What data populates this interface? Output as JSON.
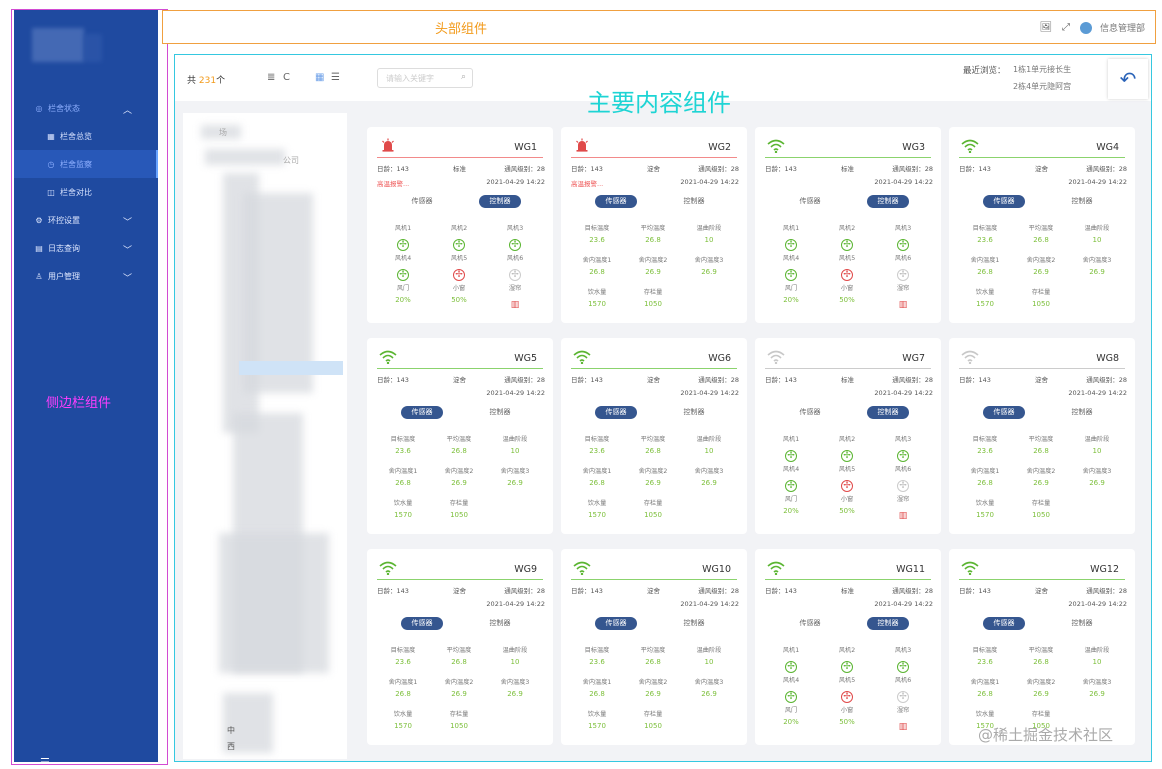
{
  "header": {
    "label": "头部组件",
    "user_name": "信息管理部",
    "icons": [
      "image-icon",
      "collapse-arrows-icon",
      "user-avatar"
    ]
  },
  "sidebar": {
    "label": "侧边栏组件",
    "items": [
      {
        "label": "栏舍状态",
        "icon": "status-icon",
        "expanded": true
      },
      {
        "label": "栏舍总览",
        "icon": "grid-icon"
      },
      {
        "label": "栏舍监察",
        "icon": "clock-icon",
        "active": true
      },
      {
        "label": "栏舍对比",
        "icon": "compare-icon"
      },
      {
        "label": "环控设置",
        "icon": "settings-icon"
      },
      {
        "label": "日志查询",
        "icon": "log-icon"
      },
      {
        "label": "用户管理",
        "icon": "user-icon"
      }
    ]
  },
  "main": {
    "label": "主要内容组件",
    "total_prefix": "共",
    "total_count": "231",
    "total_suffix": "个",
    "recent_label": "最近浏览：",
    "recent_1": "1栋1单元接长生",
    "recent_2": "2栋4单元隐阿宫",
    "search_placeholder": "请输入关键字",
    "tree": {
      "line1": "场",
      "line2": "公司",
      "line3": "中",
      "line4": "西"
    }
  },
  "cards": [
    {
      "id": "WG1",
      "status": "alarm",
      "age": "日龄：143",
      "std": "标准",
      "vent": "通风级别：28",
      "date": "2021-04-29  14:22",
      "warn": "高温报警...",
      "tab_sensor": "传感器",
      "tab_ctrl": "控制器",
      "active_tab": "ctrl",
      "view": "ctrl"
    },
    {
      "id": "WG2",
      "status": "alarm",
      "age": "日龄：143",
      "std": "淀舍",
      "vent": "通风级别：28",
      "date": "2021-04-29  14:22",
      "warn": "高温报警...",
      "tab_sensor": "传感器",
      "tab_ctrl": "控制器",
      "active_tab": "sensor",
      "view": "sensor"
    },
    {
      "id": "WG3",
      "status": "wifi-green",
      "age": "日龄：143",
      "std": "标准",
      "vent": "通风级别：28",
      "date": "2021-04-29  14:22",
      "warn": "",
      "tab_sensor": "传感器",
      "tab_ctrl": "控制器",
      "active_tab": "ctrl",
      "view": "ctrl"
    },
    {
      "id": "WG4",
      "status": "wifi-green",
      "age": "日龄：143",
      "std": "淀舍",
      "vent": "通风级别：28",
      "date": "2021-04-29  14:22",
      "warn": "",
      "tab_sensor": "传感器",
      "tab_ctrl": "控制器",
      "active_tab": "sensor",
      "view": "sensor"
    },
    {
      "id": "WG5",
      "status": "wifi-green",
      "age": "日龄：143",
      "std": "淀舍",
      "vent": "通风级别：28",
      "date": "2021-04-29  14:22",
      "warn": "",
      "tab_sensor": "传感器",
      "tab_ctrl": "控制器",
      "active_tab": "sensor",
      "view": "sensor"
    },
    {
      "id": "WG6",
      "status": "wifi-green",
      "age": "日龄：143",
      "std": "淀舍",
      "vent": "通风级别：28",
      "date": "2021-04-29  14:22",
      "warn": "",
      "tab_sensor": "传感器",
      "tab_ctrl": "控制器",
      "active_tab": "sensor",
      "view": "sensor"
    },
    {
      "id": "WG7",
      "status": "wifi-gray",
      "age": "日龄：143",
      "std": "标准",
      "vent": "通风级别：28",
      "date": "2021-04-29  14:22",
      "warn": "",
      "tab_sensor": "传感器",
      "tab_ctrl": "控制器",
      "active_tab": "ctrl",
      "view": "ctrl"
    },
    {
      "id": "WG8",
      "status": "wifi-gray",
      "age": "日龄：143",
      "std": "淀舍",
      "vent": "通风级别：28",
      "date": "2021-04-29  14:22",
      "warn": "",
      "tab_sensor": "传感器",
      "tab_ctrl": "控制器",
      "active_tab": "sensor",
      "view": "sensor"
    },
    {
      "id": "WG9",
      "status": "wifi-green",
      "age": "日龄：143",
      "std": "淀舍",
      "vent": "通风级别：28",
      "date": "2021-04-29  14:22",
      "warn": "",
      "tab_sensor": "传感器",
      "tab_ctrl": "控制器",
      "active_tab": "sensor",
      "view": "sensor"
    },
    {
      "id": "WG10",
      "status": "wifi-green",
      "age": "日龄：143",
      "std": "淀舍",
      "vent": "通风级别：28",
      "date": "2021-04-29  14:22",
      "warn": "",
      "tab_sensor": "传感器",
      "tab_ctrl": "控制器",
      "active_tab": "sensor",
      "view": "sensor"
    },
    {
      "id": "WG11",
      "status": "wifi-green",
      "age": "日龄：143",
      "std": "标准",
      "vent": "通风级别：28",
      "date": "2021-04-29  14:22",
      "warn": "",
      "tab_sensor": "传感器",
      "tab_ctrl": "控制器",
      "active_tab": "ctrl",
      "view": "ctrl"
    },
    {
      "id": "WG12",
      "status": "wifi-green",
      "age": "日龄：143",
      "std": "淀舍",
      "vent": "通风级别：28",
      "date": "2021-04-29  14:22",
      "warn": "",
      "tab_sensor": "传感器",
      "tab_ctrl": "控制器",
      "active_tab": "sensor",
      "view": "sensor"
    }
  ],
  "sensor_fields": [
    {
      "k": "目标温度",
      "v": "23.6"
    },
    {
      "k": "平均温度",
      "v": "26.8"
    },
    {
      "k": "温曲阶段",
      "v": "10"
    },
    {
      "k": "舍内温度1",
      "v": "26.8"
    },
    {
      "k": "舍内温度2",
      "v": "26.9"
    },
    {
      "k": "舍内温度3",
      "v": "26.9"
    },
    {
      "k": "饮水量",
      "v": "1570"
    },
    {
      "k": "存栏量",
      "v": "1050"
    }
  ],
  "ctrl_fields": [
    {
      "k": "风机1",
      "type": "fan",
      "state": "g"
    },
    {
      "k": "风机2",
      "type": "fan",
      "state": "g"
    },
    {
      "k": "风机3",
      "type": "fan",
      "state": "g"
    },
    {
      "k": "风机4",
      "type": "fan",
      "state": "g"
    },
    {
      "k": "风机5",
      "type": "fan",
      "state": "r"
    },
    {
      "k": "风机6",
      "type": "fan",
      "state": "x"
    },
    {
      "k": "风门",
      "type": "val",
      "v": "20%"
    },
    {
      "k": "小窗",
      "type": "val",
      "v": "50%"
    },
    {
      "k": "湿帘",
      "type": "heater",
      "state": "r"
    }
  ],
  "colors": {
    "sidebar": "#1f4aa0",
    "accent_green": "#7cbf3a",
    "alarm_red": "#e04a4a",
    "tab_active": "#35568f"
  },
  "watermark": "@稀土掘金技术社区"
}
